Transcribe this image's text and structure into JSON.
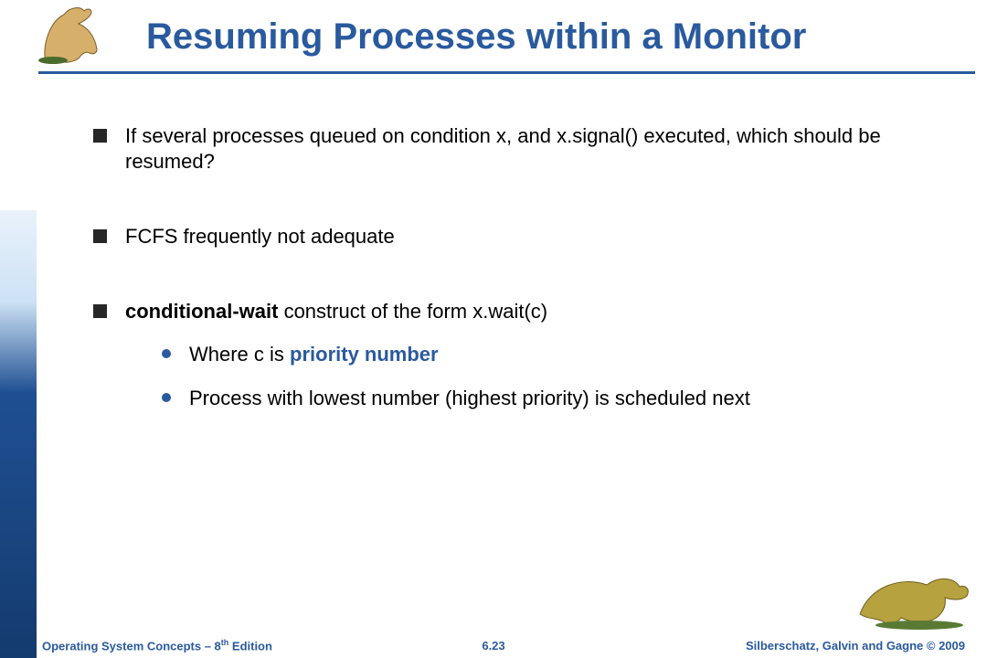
{
  "title": "Resuming Processes within a Monitor",
  "bullets": [
    {
      "text": "If several processes queued on condition x, and x.signal() executed, which should be resumed?"
    },
    {
      "text": "FCFS frequently not adequate"
    },
    {
      "lead_bold": "conditional-wait",
      "rest": " construct of the form x.wait(c)",
      "subs": [
        {
          "pre": "Where c is ",
          "bold_blue": "priority number",
          "post": ""
        },
        {
          "pre": "Process with lowest number (highest priority) is scheduled next",
          "bold_blue": "",
          "post": ""
        }
      ]
    }
  ],
  "footer": {
    "left_pre": "Operating System Concepts – 8",
    "left_sup": "th",
    "left_post": " Edition",
    "center": "6.23",
    "right": "Silberschatz, Galvin and Gagne © 2009"
  },
  "icons": {
    "dino_tl": "dinosaur-icon",
    "dino_br": "dinosaur-icon"
  }
}
